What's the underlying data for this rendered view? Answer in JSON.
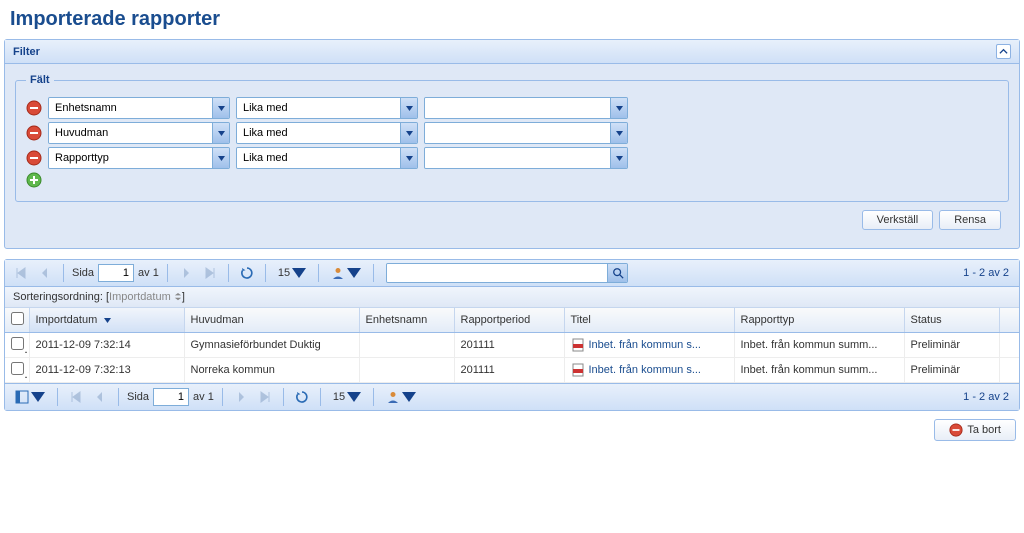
{
  "page_title": "Importerade rapporter",
  "filter": {
    "title": "Filter",
    "fieldset_label": "Fält",
    "rows": [
      {
        "field": "Enhetsnamn",
        "op": "Lika med",
        "value": ""
      },
      {
        "field": "Huvudman",
        "op": "Lika med",
        "value": ""
      },
      {
        "field": "Rapporttyp",
        "op": "Lika med",
        "value": ""
      }
    ],
    "apply_label": "Verkställ",
    "reset_label": "Rensa"
  },
  "toolbar": {
    "page_label_prefix": "Sida",
    "page_label_suffix": "av 1",
    "page_value": "1",
    "page_size": "15",
    "display": "1 - 2 av 2"
  },
  "sort": {
    "label": "Sorteringsordning:",
    "field": "Importdatum"
  },
  "columns": {
    "importdatum": "Importdatum",
    "huvudman": "Huvudman",
    "enhetsnamn": "Enhetsnamn",
    "rapportperiod": "Rapportperiod",
    "titel": "Titel",
    "rapporttyp": "Rapporttyp",
    "status": "Status"
  },
  "rows": [
    {
      "importdatum": "2011-12-09 7:32:14",
      "huvudman": "Gymnasieförbundet Duktig",
      "enhetsnamn": "",
      "rapportperiod": "201111",
      "titel": "Inbet. från kommun s...",
      "rapporttyp": "Inbet. från kommun summ...",
      "status": "Preliminär"
    },
    {
      "importdatum": "2011-12-09 7:32:13",
      "huvudman": "Norreka kommun",
      "enhetsnamn": "",
      "rapportperiod": "201111",
      "titel": "Inbet. från kommun s...",
      "rapporttyp": "Inbet. från kommun summ...",
      "status": "Preliminär"
    }
  ],
  "actions": {
    "delete_label": "Ta bort"
  }
}
